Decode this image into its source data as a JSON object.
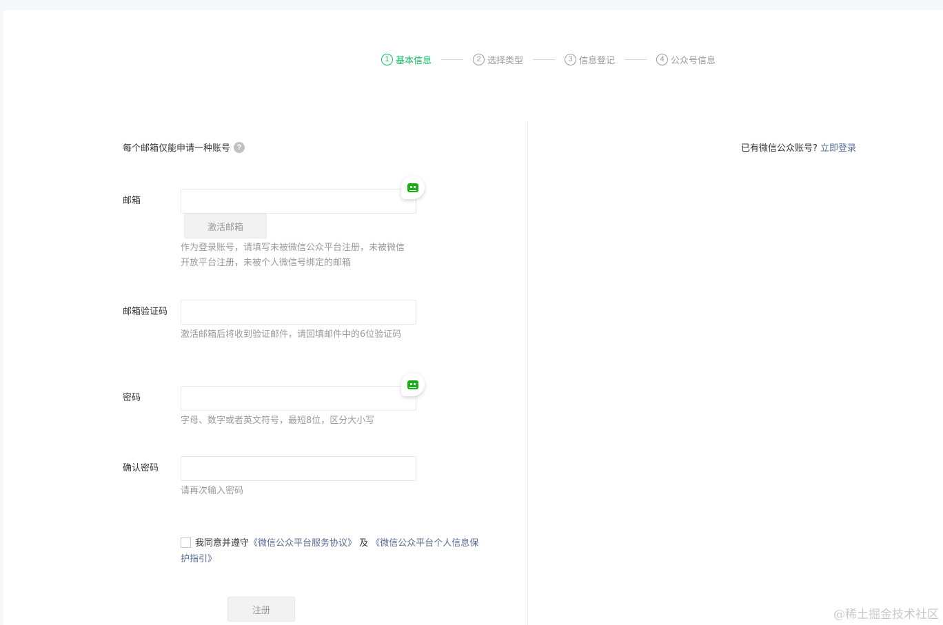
{
  "steps": [
    {
      "num": "1",
      "label": "基本信息",
      "active": true
    },
    {
      "num": "2",
      "label": "选择类型",
      "active": false
    },
    {
      "num": "3",
      "label": "信息登记",
      "active": false
    },
    {
      "num": "4",
      "label": "公众号信息",
      "active": false
    }
  ],
  "notice": {
    "text": "每个邮箱仅能申请一种账号",
    "help": "?"
  },
  "login_hint": {
    "text": "已有微信公众账号?",
    "link": "立即登录"
  },
  "email": {
    "label": "邮箱",
    "value": "",
    "activate_button": "激活邮箱",
    "tip": "作为登录账号，请填写未被微信公众平台注册，未被微信开放平台注册，未被个人微信号绑定的邮箱"
  },
  "code": {
    "label": "邮箱验证码",
    "value": "",
    "tip": "激活邮箱后将收到验证邮件，请回填邮件中的6位验证码"
  },
  "password": {
    "label": "密码",
    "value": "",
    "tip": "字母、数字或者英文符号，最短8位，区分大小写"
  },
  "confirm": {
    "label": "确认密码",
    "value": "",
    "tip": "请再次输入密码"
  },
  "agree": {
    "checked": false,
    "text1": "我同意并遵守",
    "link1": "《微信公众平台服务协议》",
    "and": " 及 ",
    "link2": "《微信公众平台个人信息保护指引》"
  },
  "register_button": "注册",
  "watermark": "@稀土掘金技术社区",
  "colors": {
    "accent": "#07c160",
    "link": "#576b95",
    "muted": "#9a9a9a"
  },
  "icons": {
    "password_manager": "robot-icon"
  }
}
